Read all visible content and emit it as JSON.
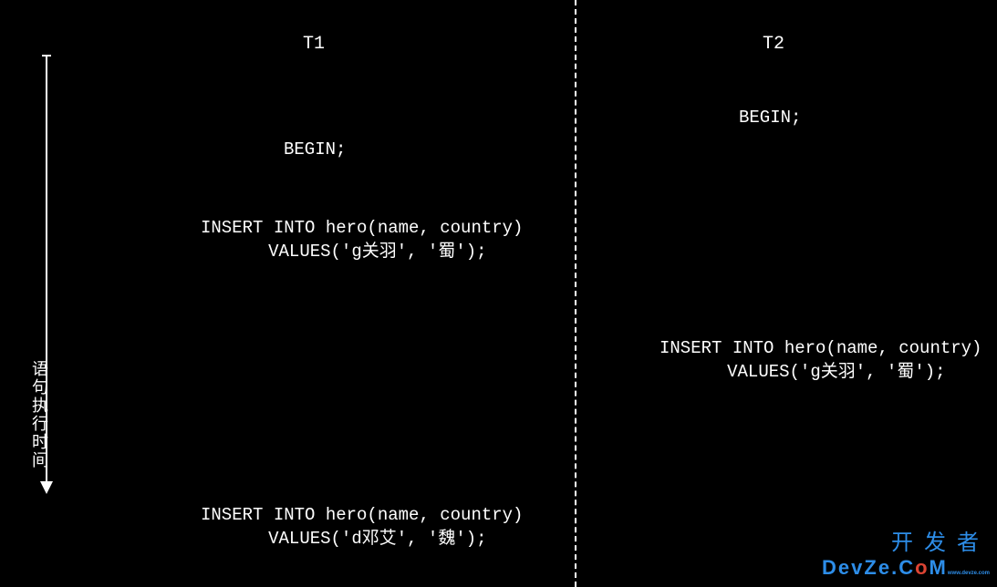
{
  "timeline": {
    "label": "语句执行时间"
  },
  "columns": {
    "t1": {
      "header": "T1"
    },
    "t2": {
      "header": "T2"
    }
  },
  "statements": {
    "t1_begin": "BEGIN;",
    "t2_begin": "BEGIN;",
    "t1_insert1": "INSERT INTO hero(name, country)\n   VALUES('g关羽', '蜀');",
    "t2_insert1": "INSERT INTO hero(name, country)\n   VALUES('g关羽', '蜀');",
    "t1_insert2": "INSERT INTO hero(name, country)\n   VALUES('d邓艾', '魏');"
  },
  "watermark": {
    "line1": "开发者",
    "line2_prefix": "DevZe.C",
    "line2_o": "o",
    "line2_m": "M",
    "sub": "www.devze.com"
  },
  "chart_data": {
    "type": "table",
    "title": "Transaction timeline comparing T1 and T2",
    "axis_label": "语句执行时间",
    "columns": [
      "T1",
      "T2"
    ],
    "rows": [
      {
        "T1": "",
        "T2": "BEGIN;"
      },
      {
        "T1": "BEGIN;",
        "T2": ""
      },
      {
        "T1": "INSERT INTO hero(name, country) VALUES('g关羽', '蜀');",
        "T2": ""
      },
      {
        "T1": "",
        "T2": "INSERT INTO hero(name, country) VALUES('g关羽', '蜀');"
      },
      {
        "T1": "INSERT INTO hero(name, country) VALUES('d邓艾', '魏');",
        "T2": ""
      }
    ]
  }
}
